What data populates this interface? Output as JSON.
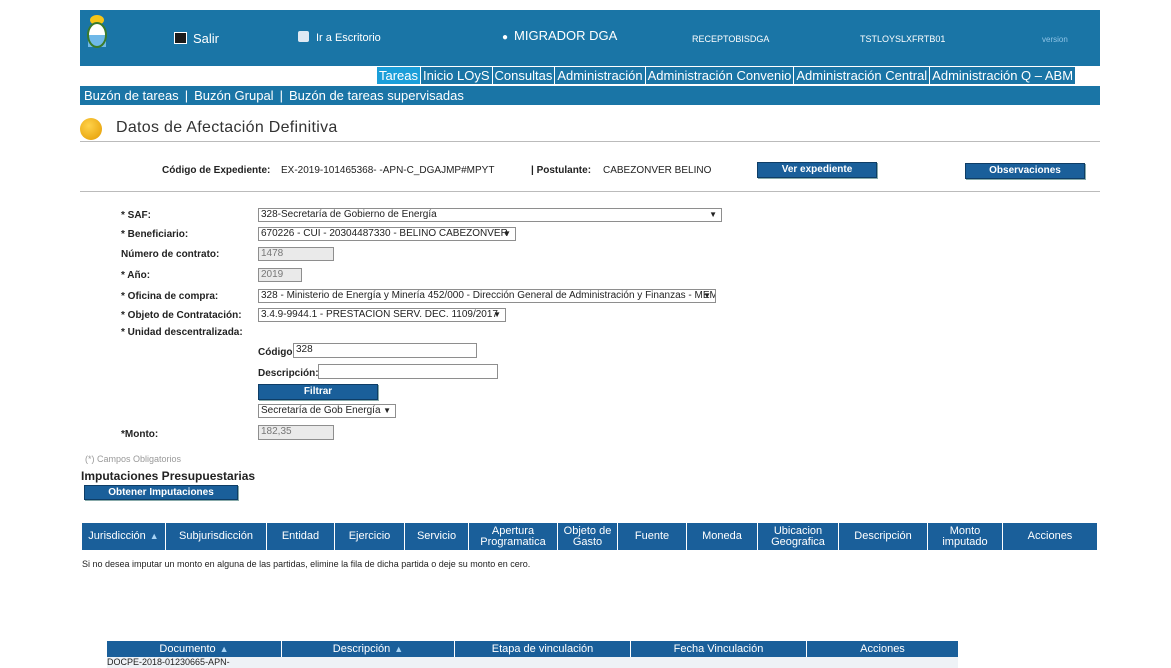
{
  "header": {
    "salir": "Salir",
    "escritorio": "Ir a Escritorio",
    "app": "MIGRADOR DGA",
    "role": "RECEPTOBISDGA",
    "user": "TSTLOYSLXFRTB01",
    "version": "version"
  },
  "menu": [
    "Tareas",
    "Inicio LOyS",
    "Consultas",
    "Administración",
    "Administración Convenio",
    "Administración Central",
    "Administración Q – ABM"
  ],
  "subnav": [
    "Buzón de tareas",
    "Buzón Grupal",
    "Buzón de tareas supervisadas"
  ],
  "page_title": "Datos de Afectación Definitiva",
  "expediente": {
    "code_label": "Código de Expediente:",
    "code_value": "EX-2019-101465368- -APN-C_DGAJMP#MPYT",
    "postulante_label": "| Postulante:",
    "postulante_value": "CABEZONVER BELINO",
    "ver_button": "Ver expediente",
    "obs_button": "Observaciones"
  },
  "form": {
    "saf_label": "* SAF:",
    "saf_value": "328-Secretaría de Gobierno de Energía",
    "beneficiario_label": "* Beneficiario:",
    "beneficiario_value": "670226 - CUI - 20304487330 - BELINO CABEZONVER",
    "contrato_label": "Número de contrato:",
    "contrato_value": "1478",
    "anio_label": "* Año:",
    "anio_value": "2019",
    "oficina_label": "* Oficina de compra:",
    "oficina_value": "328 - Ministerio de Energía y Minería 452/000 - Dirección General de Administración y Finanzas - MEM",
    "objeto_label": "* Objeto de Contratación:",
    "objeto_value": "3.4.9-9944.1 - PRESTACION SERV. DEC. 1109/2017",
    "unidad_label": "* Unidad descentralizada:",
    "codigo_label": "Código:",
    "codigo_value": "328",
    "descripcion_label": "Descripción:",
    "descripcion_value": "",
    "filtrar": "Filtrar",
    "unidad_value": "Secretaría de Gob Energía",
    "monto_label": "*Monto:",
    "monto_value": "182,35"
  },
  "obligatorios": "(*) Campos Obligatorios",
  "imputaciones": {
    "title": "Imputaciones Presupuestarias",
    "button": "Obtener Imputaciones",
    "columns": [
      "Jurisdicción",
      "Subjurisdicción",
      "Entidad",
      "Ejercicio",
      "Servicio",
      "Apertura Programatica",
      "Objeto de Gasto",
      "Fuente",
      "Moneda",
      "Ubicacion Geografica",
      "Descripción",
      "Monto imputado",
      "Acciones"
    ],
    "note": "Si no desea imputar un monto en alguna de las partidas, elimine la fila de dicha partida o deje su monto en cero."
  },
  "documentos": {
    "columns": [
      "Documento",
      "Descripción",
      "Etapa de vinculación",
      "Fecha Vinculación",
      "Acciones"
    ],
    "first_row_doc": "DOCPE-2018-01230665-APN-"
  }
}
